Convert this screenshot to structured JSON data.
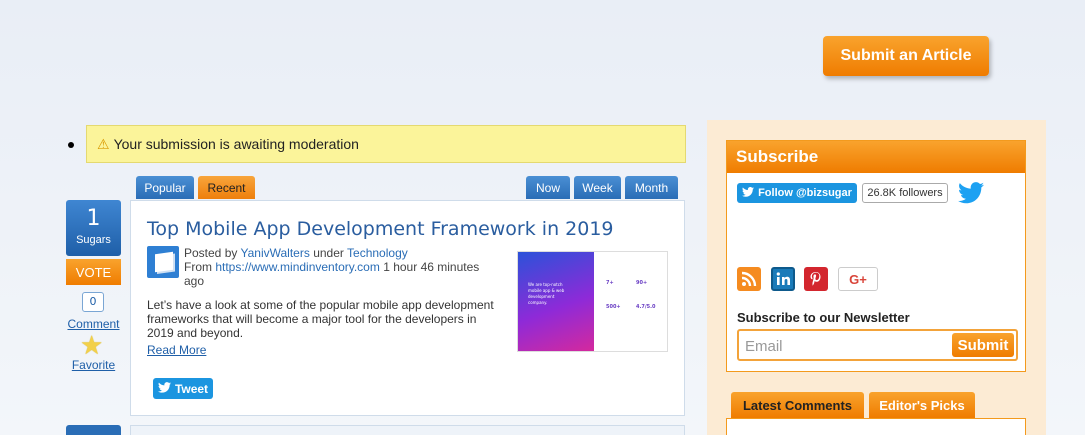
{
  "header": {
    "submit_article_label": "Submit an Article"
  },
  "notice": {
    "icon": "warning-icon",
    "text": "Your submission is awaiting moderation"
  },
  "tabs": {
    "left": [
      {
        "label": "Popular"
      },
      {
        "label": "Recent"
      }
    ],
    "right": [
      {
        "label": "Now"
      },
      {
        "label": "Week"
      },
      {
        "label": "Month"
      }
    ]
  },
  "article": {
    "sugars_count": "1",
    "sugars_label": "Sugars",
    "vote_label": "VOTE",
    "comment_count": "0",
    "comment_label": "Comment",
    "favorite_label": "Favorite",
    "title": "Top Mobile App Development Framework in 2019",
    "posted_by_prefix": "Posted by",
    "author": "YanivWalters",
    "under": "under",
    "category": "Technology",
    "from_prefix": "From",
    "source_url": "https://www.mindinventory.com",
    "time_ago": "1 hour 46 minutes ago",
    "excerpt": "Let’s have a look at some of the popular mobile app development frameworks that will become a major tool for the developers in 2019 and beyond.",
    "read_more_label": "Read More",
    "tweet_label": "Tweet",
    "thumbnail": {
      "headline": "We are top-notch mobile app & web development company.",
      "stats": [
        "7+",
        "90+",
        "500+",
        "4.7/5.0"
      ]
    }
  },
  "sidebar": {
    "subscribe_title": "Subscribe",
    "follow_label": "Follow @bizsugar",
    "followers": "26.8K followers",
    "social_icons": [
      "rss-icon",
      "linkedin-icon",
      "pinterest-icon",
      "google-plus-icon"
    ],
    "gplus_text": "G+",
    "newsletter_title": "Subscribe to our Newsletter",
    "email_placeholder": "Email",
    "submit_label": "Submit",
    "tabs": [
      {
        "label": "Latest Comments"
      },
      {
        "label": "Editor's Picks"
      }
    ]
  },
  "colors": {
    "accent_orange": "#ef7c00",
    "accent_blue": "#2a6db6",
    "twitter_blue": "#1b95e0"
  }
}
